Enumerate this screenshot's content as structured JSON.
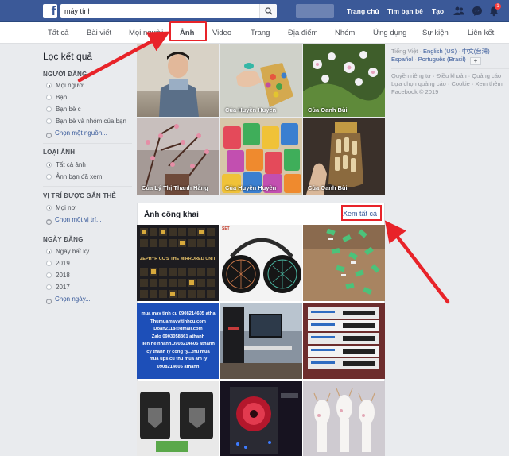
{
  "topbar": {
    "logo": "f",
    "search_value": "máy tính",
    "nav_home": "Trang chủ",
    "nav_find_friends": "Tìm bạn bè",
    "nav_create": "Tạo",
    "notif_count": "1",
    "brand_color": "#3b5998"
  },
  "tabs": [
    {
      "label": "Tất cả"
    },
    {
      "label": "Bài viết"
    },
    {
      "label": "Mọi người"
    },
    {
      "label": "Ảnh"
    },
    {
      "label": "Video"
    },
    {
      "label": "Trang"
    },
    {
      "label": "Địa điểm"
    },
    {
      "label": "Nhóm"
    },
    {
      "label": "Ứng dụng"
    },
    {
      "label": "Sự kiện"
    },
    {
      "label": "Liên kết"
    }
  ],
  "sidebar": {
    "title": "Lọc kết quả",
    "sections": [
      {
        "heading": "NGƯỜI ĐĂNG",
        "options": [
          "Mọi người",
          "Bạn",
          "Bạn bè c",
          "Bạn bè và nhóm của bạn"
        ],
        "selected": 0,
        "link": "Chọn một nguồn..."
      },
      {
        "heading": "LOẠI ẢNH",
        "options": [
          "Tất cả ảnh",
          "Ảnh bạn đã xem"
        ],
        "selected": 0,
        "link": ""
      },
      {
        "heading": "VỊ TRÍ ĐƯỢC GẮN THẺ",
        "options": [
          "Mọi nơi"
        ],
        "selected": 0,
        "link": "Chọn một vị trí..."
      },
      {
        "heading": "NGÀY ĐĂNG",
        "options": [
          "Ngày bất kỳ",
          "2019",
          "2018",
          "2017"
        ],
        "selected": 0,
        "link": "Chọn ngày..."
      }
    ]
  },
  "top_photos": [
    {
      "caption": "",
      "icon": "photo-boy"
    },
    {
      "caption": "Của Huyền Huyền",
      "icon": "photo-candy"
    },
    {
      "caption": "Của Oanh Bùi",
      "icon": "photo-flowers"
    },
    {
      "caption": "Của Lý Thị Thanh Hằng",
      "icon": "photo-blossoms"
    },
    {
      "caption": "Của Huyền Huyền",
      "icon": "photo-colorful-bags"
    },
    {
      "caption": "Của Oanh Bùi",
      "icon": "photo-jar"
    }
  ],
  "public_photos": {
    "title": "Ảnh công khai",
    "see_all": "Xem tất cả",
    "tiles": [
      {
        "icon": "photo-calculator-grid",
        "text": "ZEPHYR CC'S THE MIRRORED UNIT"
      },
      {
        "icon": "photo-headphones",
        "text": "SET"
      },
      {
        "icon": "photo-green-parts",
        "text": ""
      },
      {
        "icon": "photo-ad-text",
        "lines": [
          "mua may tinh cu 0908214605 atha",
          "Thumuamayvitinhcu.com",
          "Doan2118@gmail.com",
          "Zalo 0903058861 athanh",
          "lien he nhanh.0908214605 athanh",
          "cy thanh ly cong ty...thu mua",
          "mua ups cu thu mua am ly",
          "0908214605 athanh"
        ]
      },
      {
        "icon": "photo-computer-desk",
        "text": ""
      },
      {
        "icon": "photo-sim-cards",
        "text": ""
      },
      {
        "icon": "photo-speakers",
        "text": ""
      },
      {
        "icon": "photo-pc-case-red",
        "text": ""
      },
      {
        "icon": "photo-deer-figurines",
        "text": ""
      }
    ]
  },
  "right_column": {
    "languages": [
      "Tiếng Việt",
      "English (US)",
      "中文(台灣)",
      "Español",
      "Português (Brasil)"
    ],
    "footer_links": [
      "Quyền riêng tư",
      "Điều khoản",
      "Quảng cáo",
      "Lựa chọn quảng cáo",
      "Cookie",
      "Xem thêm"
    ],
    "copyright": "Facebook © 2019"
  },
  "annotation_color": "#e82329"
}
